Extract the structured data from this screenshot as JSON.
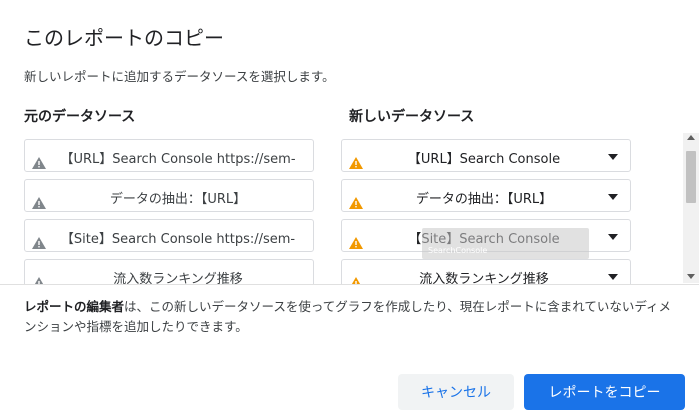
{
  "dialog": {
    "title": "このレポートのコピー",
    "subtitle": "新しいレポートに追加するデータソースを選択します。"
  },
  "columns": {
    "source_header": "元のデータソース",
    "target_header": "新しいデータソース"
  },
  "rows": [
    {
      "source": "【URL】Search Console https://sem-",
      "target": "【URL】Search Console"
    },
    {
      "source": "データの抽出：【URL】",
      "target": "データの抽出：【URL】"
    },
    {
      "source": "【Site】Search Console https://sem-",
      "target": "【Site】Search Console"
    },
    {
      "source": "流入数ランキング推移",
      "target": "流入数ランキング推移"
    }
  ],
  "tooltip": {
    "text": "SearchConsole"
  },
  "info": {
    "bold": "レポートの編集者",
    "text": "は、この新しいデータソースを使ってグラフを作成したり、現在レポートに含まれていないディメンションや指標を追加したりできます。"
  },
  "buttons": {
    "cancel": "キャンセル",
    "copy": "レポートをコピー"
  },
  "colors": {
    "accent": "#1a73e8",
    "warning_orange": "#f29900",
    "warning_gray": "#80868b"
  },
  "icons": {
    "source_warning": "warning-icon",
    "target_warning": "warning-icon",
    "dropdown": "caret-down-icon"
  }
}
